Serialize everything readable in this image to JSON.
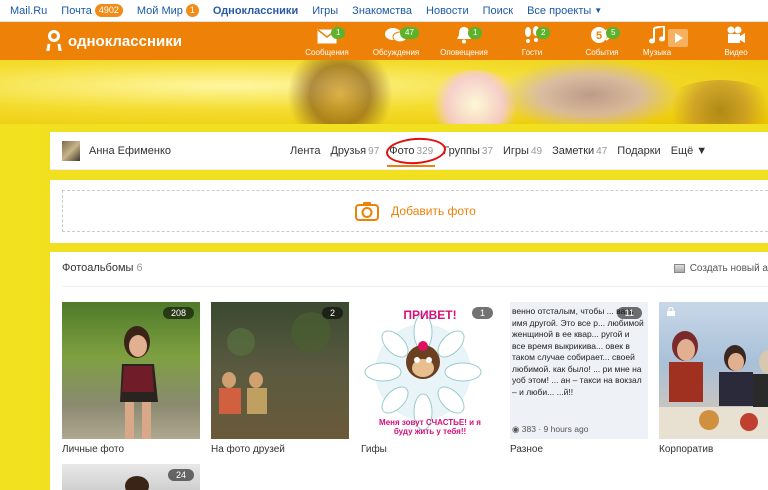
{
  "topbar": {
    "items": [
      {
        "label": "Mail.Ru"
      },
      {
        "label": "Почта",
        "badge": "4902"
      },
      {
        "label": "Мой Мир",
        "badge": "1"
      },
      {
        "label": "Одноклассники"
      },
      {
        "label": "Игры"
      },
      {
        "label": "Знакомства"
      },
      {
        "label": "Новости"
      },
      {
        "label": "Поиск"
      },
      {
        "label": "Все проекты"
      }
    ]
  },
  "header": {
    "logo": "одноклассники",
    "nav": [
      {
        "label": "Сообщения",
        "count": "1",
        "icon": "envelope-icon"
      },
      {
        "label": "Обсуждения",
        "count": "47",
        "icon": "chat-bubbles-icon"
      },
      {
        "label": "Оповещения",
        "count": "1",
        "icon": "bell-icon"
      },
      {
        "label": "Гости",
        "count": "2",
        "icon": "footprints-icon"
      },
      {
        "label": "События",
        "count": "5",
        "icon": "events-icon",
        "inner": "5"
      },
      {
        "label": "Музыка",
        "icon": "music-note-icon"
      },
      {
        "label": "Видео",
        "icon": "video-camera-icon"
      }
    ]
  },
  "profile": {
    "name": "Анна Ефименко",
    "tabs": [
      {
        "label": "Лента",
        "count": ""
      },
      {
        "label": "Друзья",
        "count": "97"
      },
      {
        "label": "Фото",
        "count": "329"
      },
      {
        "label": "Группы",
        "count": "37"
      },
      {
        "label": "Игры",
        "count": "49"
      },
      {
        "label": "Заметки",
        "count": "47"
      },
      {
        "label": "Подарки",
        "count": ""
      },
      {
        "label": "Ещё ▼",
        "count": ""
      }
    ]
  },
  "upload": {
    "label": "Добавить фото"
  },
  "albums": {
    "title": "Фотоальбомы",
    "count": "6",
    "create_label": "Создать новый а",
    "items": [
      {
        "name": "Личные фото",
        "count": "208"
      },
      {
        "name": "На фото друзей",
        "count": "2"
      },
      {
        "name": "Гифы",
        "count": "1",
        "caption_top": "ПРИВЕТ!",
        "caption_bottom": "Меня зовут СЧАСТЬЕ! и я буду жить у тебя!!"
      },
      {
        "name": "Разное",
        "count": "11",
        "text": "венно отсталым, чтобы ... вать имя другой. Это все р... любимой женщиной в ее квар... ругой и все время выкрикива... овек в таком случае собирает... своей любимой. как было! ... ри мне на уоб этом! ... ан – такси на вокзал – и люби... ...й!!",
        "stats": "383 · 9 hours ago"
      },
      {
        "name": "Корпоратив",
        "count": ""
      },
      {
        "name": "",
        "count": "24"
      }
    ]
  },
  "colors": {
    "accent": "#ee8208",
    "badge_green": "#5db12b",
    "link": "#1b5aa8",
    "highlight_circle": "#e01010"
  }
}
